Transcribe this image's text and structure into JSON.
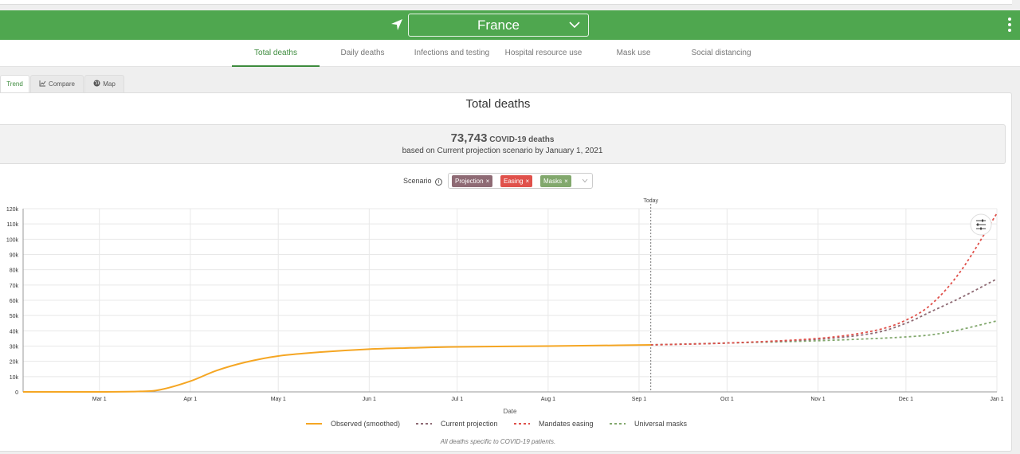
{
  "header": {
    "country": "France",
    "accent_color": "#4fa74f",
    "location_icon": "navigation-arrow-icon",
    "menu_icon": "kebab-menu-icon"
  },
  "tabs": [
    {
      "label": "Total deaths",
      "active": true
    },
    {
      "label": "Daily deaths",
      "active": false
    },
    {
      "label": "Infections and testing",
      "active": false
    },
    {
      "label": "Hospital resource use",
      "active": false
    },
    {
      "label": "Mask use",
      "active": false
    },
    {
      "label": "Social distancing",
      "active": false
    }
  ],
  "subtabs": [
    {
      "label": "Trend",
      "active": true
    },
    {
      "label": "Compare",
      "icon": "line-chart-icon",
      "active": false
    },
    {
      "label": "Map",
      "icon": "globe-icon",
      "active": false
    }
  ],
  "panel": {
    "title": "Total deaths",
    "summary_number": "73,743",
    "summary_unit": "COVID-19 deaths",
    "summary_sub": "based on Current projection scenario by January 1, 2021"
  },
  "scenario": {
    "label": "Scenario",
    "chips": [
      {
        "label": "Projection",
        "color": "#8e6a74"
      },
      {
        "label": "Easing",
        "color": "#e0514b"
      },
      {
        "label": "Masks",
        "color": "#82a86d"
      }
    ]
  },
  "chart_data": {
    "type": "line",
    "xlabel": "Date",
    "ylabel": "",
    "ylim": [
      0,
      120000
    ],
    "y_ticks": [
      "0",
      "10k",
      "20k",
      "30k",
      "40k",
      "50k",
      "60k",
      "70k",
      "80k",
      "90k",
      "100k",
      "110k",
      "120k"
    ],
    "x_ticks": [
      {
        "label": "Mar 1",
        "date": "2020-03-01"
      },
      {
        "label": "Apr 1",
        "date": "2020-04-01"
      },
      {
        "label": "May 1",
        "date": "2020-05-01"
      },
      {
        "label": "Jun 1",
        "date": "2020-06-01"
      },
      {
        "label": "Jul 1",
        "date": "2020-07-01"
      },
      {
        "label": "Aug 1",
        "date": "2020-08-01"
      },
      {
        "label": "Sep 1",
        "date": "2020-09-01"
      },
      {
        "label": "Oct 1",
        "date": "2020-10-01"
      },
      {
        "label": "Nov 1",
        "date": "2020-11-01"
      },
      {
        "label": "Dec 1",
        "date": "2021-12-01"
      },
      {
        "label": "Jan 1",
        "date": "2021-01-01"
      }
    ],
    "xlim": [
      "2020-02-04",
      "2021-01-01"
    ],
    "today": {
      "label": "Today",
      "date": "2020-09-05"
    },
    "grid": true,
    "legend_position": "bottom",
    "series": [
      {
        "name": "Observed (smoothed)",
        "color": "#f5a623",
        "style": "solid",
        "points": [
          [
            "2020-02-04",
            0
          ],
          [
            "2020-03-01",
            0
          ],
          [
            "2020-03-15",
            300
          ],
          [
            "2020-03-22",
            1500
          ],
          [
            "2020-04-01",
            7000
          ],
          [
            "2020-04-10",
            14000
          ],
          [
            "2020-04-20",
            19500
          ],
          [
            "2020-05-01",
            23500
          ],
          [
            "2020-05-15",
            26000
          ],
          [
            "2020-06-01",
            28000
          ],
          [
            "2020-06-15",
            28800
          ],
          [
            "2020-07-01",
            29500
          ],
          [
            "2020-08-01",
            30000
          ],
          [
            "2020-08-25",
            30500
          ],
          [
            "2020-09-05",
            30800
          ]
        ]
      },
      {
        "name": "Current projection",
        "color": "#8e6a74",
        "style": "dashed",
        "points": [
          [
            "2020-09-05",
            30800
          ],
          [
            "2020-10-01",
            32000
          ],
          [
            "2020-11-01",
            34500
          ],
          [
            "2020-11-20",
            38500
          ],
          [
            "2020-12-01",
            45000
          ],
          [
            "2020-12-10",
            53000
          ],
          [
            "2020-12-20",
            62000
          ],
          [
            "2021-01-01",
            74000
          ]
        ]
      },
      {
        "name": "Mandates easing",
        "color": "#e0514b",
        "style": "dashed",
        "points": [
          [
            "2020-09-05",
            30800
          ],
          [
            "2020-10-01",
            32000
          ],
          [
            "2020-11-01",
            35000
          ],
          [
            "2020-11-20",
            40000
          ],
          [
            "2020-12-01",
            47000
          ],
          [
            "2020-12-10",
            58000
          ],
          [
            "2020-12-20",
            80000
          ],
          [
            "2021-01-01",
            117000
          ]
        ]
      },
      {
        "name": "Universal masks",
        "color": "#82a86d",
        "style": "dashed",
        "points": [
          [
            "2020-09-05",
            30800
          ],
          [
            "2020-10-01",
            32000
          ],
          [
            "2020-11-01",
            33500
          ],
          [
            "2020-12-01",
            36000
          ],
          [
            "2020-12-15",
            39000
          ],
          [
            "2021-01-01",
            46500
          ]
        ]
      }
    ],
    "footnote": "All deaths specific to COVID-19 patients."
  }
}
